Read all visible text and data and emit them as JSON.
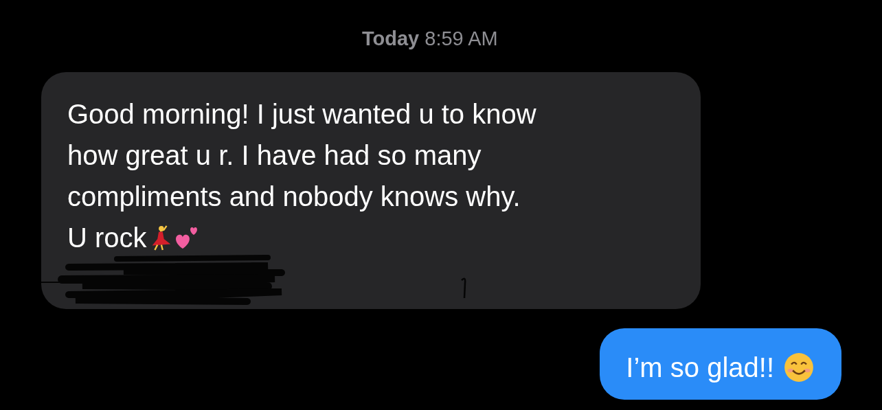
{
  "timestamp": {
    "day": "Today",
    "time": "8:59 AM"
  },
  "messages": [
    {
      "kind": "incoming",
      "lines": [
        "Good morning! I just wanted u to know",
        "how great u r. I have had so many",
        "compliments and nobody knows why.",
        "U rock"
      ],
      "redacted": true
    },
    {
      "kind": "outgoing",
      "lines": [
        "I’m so glad!!"
      ],
      "redacted": false
    }
  ]
}
